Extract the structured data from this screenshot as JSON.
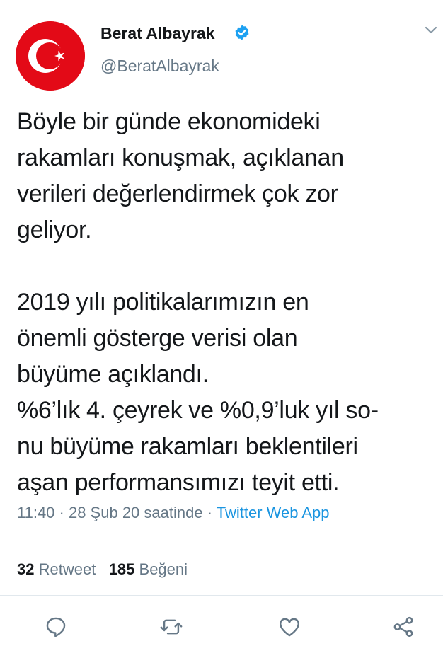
{
  "user": {
    "display_name": "Berat Albayrak",
    "handle": "@BeratAlbayrak",
    "verified": true,
    "avatar_icon": "turkish-flag-crescent-star"
  },
  "tweet": {
    "text": "Böyle bir günde ekonomideki\nrakamları konuşmak, açıklanan\nverileri değerlendirmek çok zor\ngeliyor.\n\n2019 yılı politikalarımızın en\nönemli gösterge verisi olan\nbüyüme açıklandı.\n%6’lık 4. çeyrek ve %0,9’luk yıl so-\nnu büyüme rakamları beklentileri\naşan performansımızı teyit etti.",
    "time": "11:40",
    "separator": " · ",
    "date": "28 Şub 20 saatinde",
    "source": "Twitter Web App"
  },
  "stats": {
    "retweet_count": "32",
    "retweet_label": "Retweet",
    "like_count": "185",
    "like_label": "Beğeni"
  },
  "actions": [
    "reply-icon",
    "retweet-icon",
    "like-icon",
    "share-icon"
  ],
  "colors": {
    "text": "#14171a",
    "secondary": "#657786",
    "link": "#1b95e0",
    "verified": "#1da1f2",
    "avatar": "#e30a17",
    "divider": "#e1e8ed"
  }
}
